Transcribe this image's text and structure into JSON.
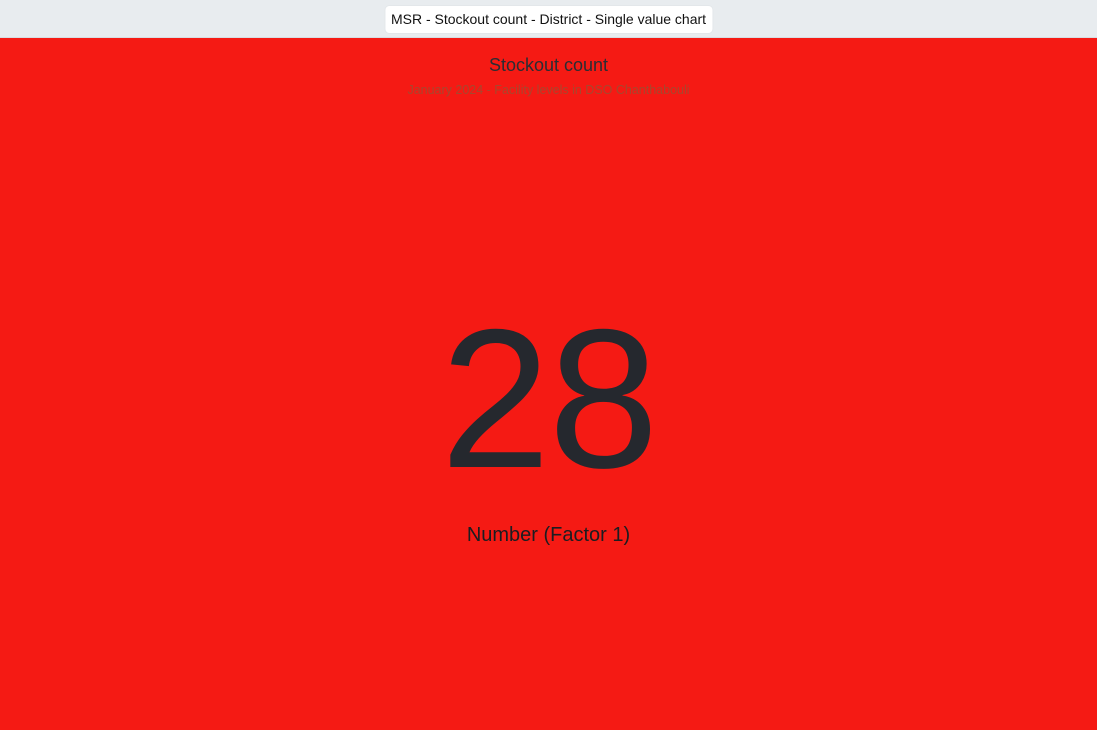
{
  "header": {
    "title": "MSR - Stockout count - District - Single value chart"
  },
  "chart_data": {
    "type": "table",
    "title": "Stockout count",
    "subtitle": "January 2024 - Facility levels in DSO Chanthabouli",
    "value": "28",
    "value_label": "Number (Factor 1)",
    "background_color": "#f51a14",
    "text_color": "#25282e"
  }
}
